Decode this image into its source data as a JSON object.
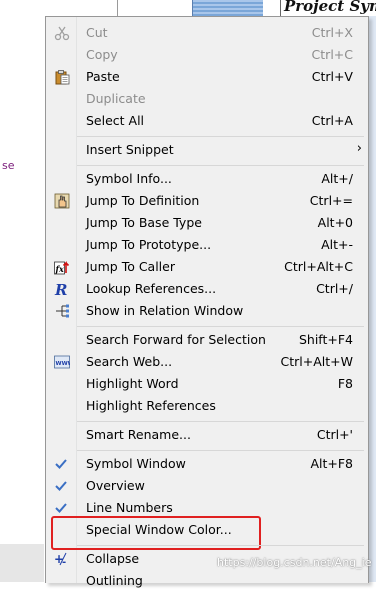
{
  "background": {
    "title_fragment": "Project Sym",
    "code_fragment": "se"
  },
  "menu": {
    "items": [
      {
        "label": "Cut",
        "shortcut": "Ctrl+X",
        "disabled": true,
        "icon": "scissors-icon"
      },
      {
        "label": "Copy",
        "shortcut": "Ctrl+C",
        "disabled": true,
        "icon": ""
      },
      {
        "label": "Paste",
        "shortcut": "Ctrl+V",
        "disabled": false,
        "icon": "clipboard-icon"
      },
      {
        "label": "Duplicate",
        "shortcut": "",
        "disabled": true,
        "icon": ""
      },
      {
        "label": "Select All",
        "shortcut": "Ctrl+A",
        "disabled": false,
        "icon": ""
      },
      {
        "label": "Insert Snippet",
        "shortcut": "",
        "disabled": false,
        "icon": "",
        "submenu": "›"
      },
      {
        "label": "Symbol Info...",
        "shortcut": "Alt+/",
        "disabled": false,
        "icon": ""
      },
      {
        "label": "Jump To Definition",
        "shortcut": "Ctrl+=",
        "disabled": false,
        "icon": "hand-icon"
      },
      {
        "label": "Jump To Base Type",
        "shortcut": "Alt+0",
        "disabled": false,
        "icon": ""
      },
      {
        "label": "Jump To Prototype...",
        "shortcut": "Alt+-",
        "disabled": false,
        "icon": ""
      },
      {
        "label": "Jump To Caller",
        "shortcut": "Ctrl+Alt+C",
        "disabled": false,
        "icon": "function-caller-icon"
      },
      {
        "label": "Lookup References...",
        "shortcut": "Ctrl+/",
        "disabled": false,
        "icon": "references-icon"
      },
      {
        "label": "Show in Relation Window",
        "shortcut": "",
        "disabled": false,
        "icon": "relation-icon"
      },
      {
        "label": "Search Forward for Selection",
        "shortcut": "Shift+F4",
        "disabled": false,
        "icon": ""
      },
      {
        "label": "Search Web...",
        "shortcut": "Ctrl+Alt+W",
        "disabled": false,
        "icon": "web-icon"
      },
      {
        "label": "Highlight Word",
        "shortcut": "F8",
        "disabled": false,
        "icon": ""
      },
      {
        "label": "Highlight References",
        "shortcut": "",
        "disabled": false,
        "icon": ""
      },
      {
        "label": "Smart Rename...",
        "shortcut": "Ctrl+'",
        "disabled": false,
        "icon": ""
      },
      {
        "label": "Symbol Window",
        "shortcut": "Alt+F8",
        "disabled": false,
        "checked": true
      },
      {
        "label": "Overview",
        "shortcut": "",
        "disabled": false,
        "checked": true
      },
      {
        "label": "Line Numbers",
        "shortcut": "",
        "disabled": false,
        "checked": true
      },
      {
        "label": "Special Window Color...",
        "shortcut": "",
        "disabled": false
      },
      {
        "label": "Collapse",
        "shortcut": "",
        "disabled": false,
        "icon": "collapse-icon"
      },
      {
        "label": "Outlining",
        "shortcut": "",
        "disabled": false
      }
    ]
  },
  "watermark": "https://blog.csdn.net/Ang_ie",
  "accent_color": "#e02020",
  "check_color": "#3a6fc4"
}
